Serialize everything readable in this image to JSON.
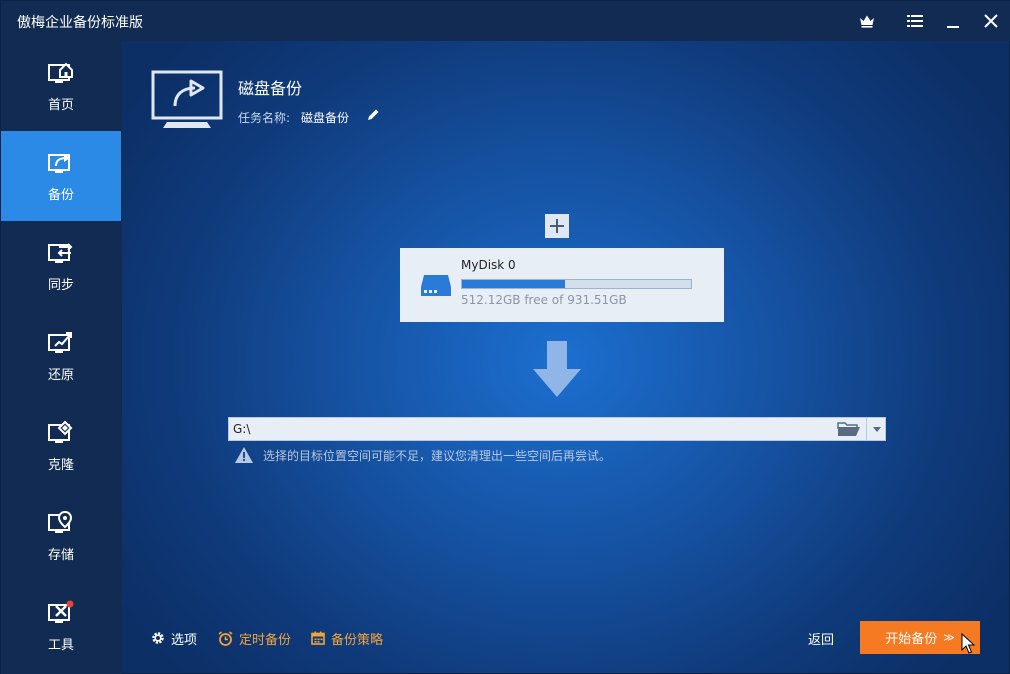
{
  "window": {
    "title": "傲梅企业备份标准版"
  },
  "titlebar_icons": [
    "crown-icon",
    "menu-icon",
    "minimize-icon",
    "close-icon"
  ],
  "sidebar": {
    "items": [
      {
        "label": "首页",
        "icon": "home-monitor-icon",
        "active": false
      },
      {
        "label": "备份",
        "icon": "backup-monitor-icon",
        "active": true
      },
      {
        "label": "同步",
        "icon": "sync-monitor-icon",
        "active": false
      },
      {
        "label": "还原",
        "icon": "restore-monitor-icon",
        "active": false
      },
      {
        "label": "克隆",
        "icon": "clone-monitor-icon",
        "active": false
      },
      {
        "label": "存储",
        "icon": "storage-location-icon",
        "active": false
      },
      {
        "label": "工具",
        "icon": "tools-monitor-icon",
        "active": false
      }
    ]
  },
  "task": {
    "title": "磁盘备份",
    "name_label": "任务名称:",
    "name_value": "磁盘备份"
  },
  "source": {
    "add_label": "+",
    "disk_name": "MyDisk 0",
    "free_text": "512.12GB free of 931.51GB",
    "used_fraction": 0.45
  },
  "destination": {
    "path": "G:\\",
    "warning": "选择的目标位置空间可能不足，建议您清理出一些空间后再尝试。"
  },
  "bottom": {
    "options_label": "选项",
    "schedule_label": "定时备份",
    "scheme_label": "备份策略",
    "back_label": "返回",
    "start_label": "开始备份",
    "start_chevron": "≫"
  },
  "colors": {
    "sidebar_bg": "#112b52",
    "active_nav": "#2a8ae6",
    "accent_orange": "#f57a22",
    "link_orange": "#f2a43a"
  }
}
